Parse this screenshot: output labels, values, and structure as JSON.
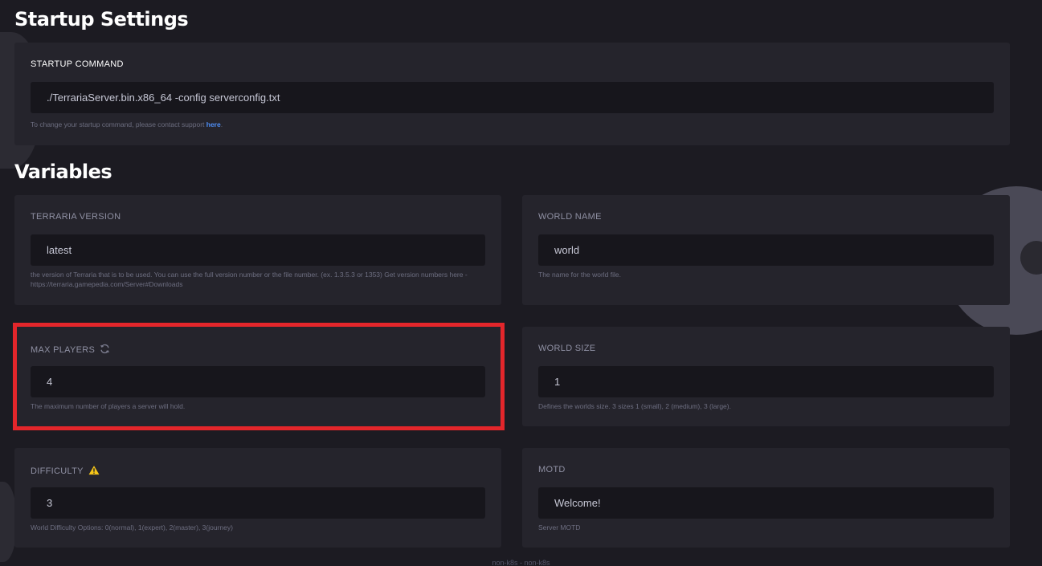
{
  "startup": {
    "heading": "Startup Settings",
    "command_label": "STARTUP COMMAND",
    "command_value": "./TerrariaServer.bin.x86_64 -config serverconfig.txt",
    "help_text": "To change your startup command, please contact support ",
    "help_link": "here",
    "help_suffix": "."
  },
  "variables": {
    "heading": "Variables",
    "items": [
      {
        "label": "TERRARIA VERSION",
        "value": "latest",
        "help": "the version of Terraria that is to be used. You can use the full version number or the file number. (ex. 1.3.5.3 or 1353) Get version numbers here - https://terraria.gamepedia.com/Server#Downloads"
      },
      {
        "label": "WORLD NAME",
        "value": "world",
        "help": "The name for the world file."
      },
      {
        "label": "MAX PLAYERS",
        "value": "4",
        "help": "The maximum number of players a server will hold.",
        "icon": "refresh-icon"
      },
      {
        "label": "WORLD SIZE",
        "value": "1",
        "help": "Defines the worlds size. 3 sizes 1 (small), 2 (medium), 3 (large)."
      },
      {
        "label": "DIFFICULTY",
        "value": "3",
        "help": "World Difficulty Options: 0(normal), 1(expert), 2(master), 3(journey)",
        "icon": "warning-icon"
      },
      {
        "label": "MOTD",
        "value": "Welcome!",
        "help": "Server MOTD"
      }
    ]
  },
  "footer": {
    "text": "non-k8s - non-k8s"
  },
  "colors": {
    "background": "#1c1b22",
    "panel": "#25242c",
    "input": "#17161c",
    "link": "#4f8ff7",
    "highlight": "#e3262b",
    "warning": "#f5c518"
  }
}
